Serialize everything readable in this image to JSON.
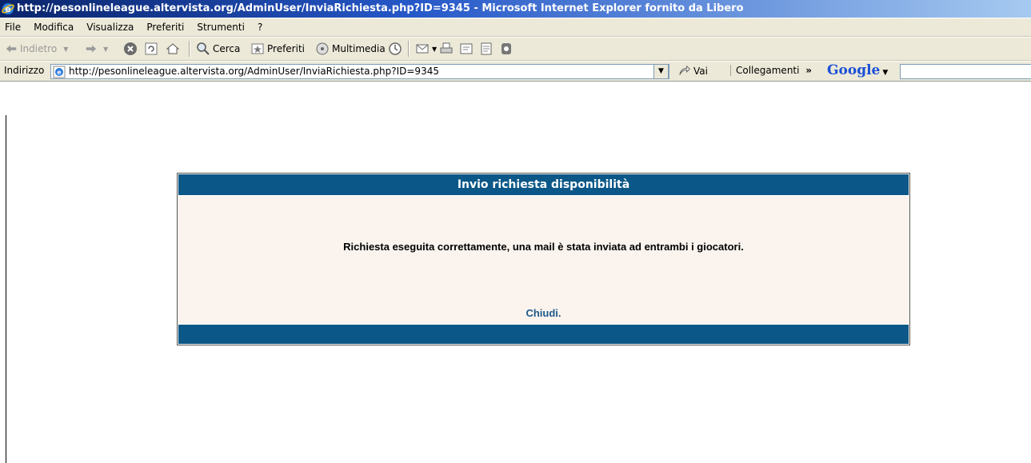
{
  "window": {
    "title": "http://pesonlineleague.altervista.org/AdminUser/InviaRichiesta.php?ID=9345 - Microsoft Internet Explorer fornito da Libero"
  },
  "menu": [
    "File",
    "Modifica",
    "Visualizza",
    "Preferiti",
    "Strumenti",
    "?"
  ],
  "toolbar": {
    "back_label": "Indietro",
    "search_label": "Cerca",
    "favorites_label": "Preferiti",
    "media_label": "Multimedia"
  },
  "address": {
    "label": "Indirizzo",
    "url": "http://pesonlineleague.altervista.org/AdminUser/InviaRichiesta.php?ID=9345",
    "go_label": "Vai",
    "links_label": "Collegamenti",
    "links_chevron": "»",
    "google_label": "Google"
  },
  "panel": {
    "header": "Invio richiesta disponibilità",
    "message": "Richiesta eseguita correttamente, una mail è stata inviata ad entrambi i giocatori.",
    "close_link": "Chiudi."
  },
  "colors": {
    "panel_header": "#0b5888",
    "panel_body": "#faf3ee",
    "link": "#1f5a8a"
  }
}
